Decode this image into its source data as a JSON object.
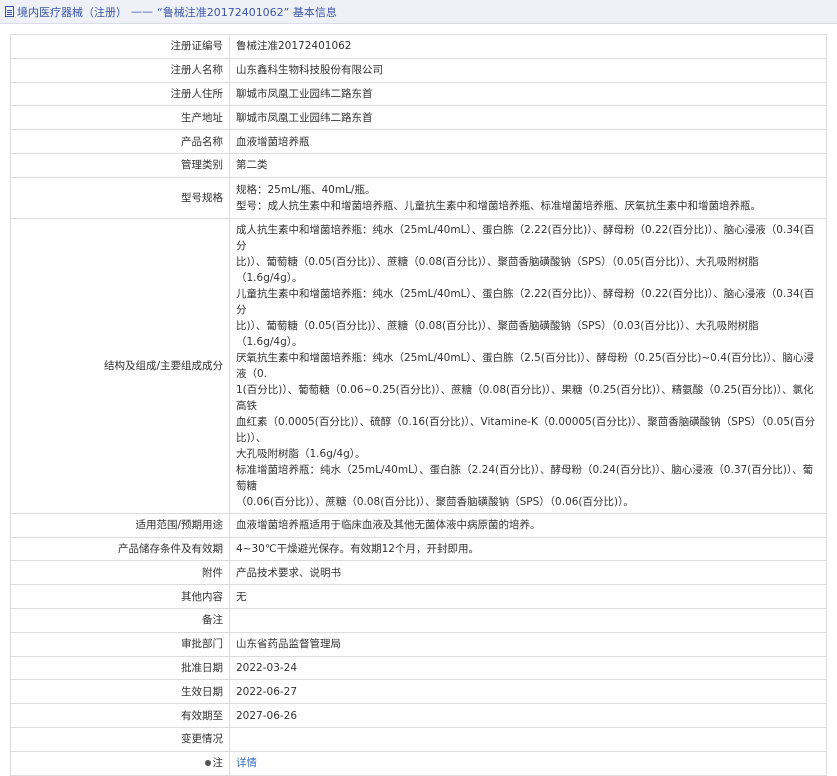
{
  "header": {
    "section": "境内医疗器械（注册）",
    "separator": "——",
    "title": "“鲁械注准20172401062” 基本信息"
  },
  "rows": [
    {
      "label": "注册证编号",
      "value": "鲁械注准20172401062"
    },
    {
      "label": "注册人名称",
      "value": "山东鑫科生物科技股份有限公司"
    },
    {
      "label": "注册人住所",
      "value": "聊城市凤凰工业园纬二路东首"
    },
    {
      "label": "生产地址",
      "value": "聊城市凤凰工业园纬二路东首"
    },
    {
      "label": "产品名称",
      "value": "血液增菌培养瓶"
    },
    {
      "label": "管理类别",
      "value": "第二类"
    },
    {
      "label": "型号规格",
      "lines": [
        "规格：25mL/瓶、40mL/瓶。",
        "型号：成人抗生素中和增菌培养瓶、儿童抗生素中和增菌培养瓶、标准增菌培养瓶、厌氧抗生素中和增菌培养瓶。"
      ]
    },
    {
      "label": "结构及组成/主要组成成分",
      "lines": [
        "成人抗生素中和增菌培养瓶：纯水（25mL/40mL）、蛋白胨（2.22(百分比)）、酵母粉（0.22(百分比)）、脑心浸液（0.34(百分",
        "比)）、葡萄糖（0.05(百分比)）、蔗糖（0.08(百分比)）、聚茴香脑磺酸钠（SPS）（0.05(百分比)）、大孔吸附树脂（1.6g/4g）。",
        "儿童抗生素中和增菌培养瓶：纯水（25mL/40mL）、蛋白胨（2.22(百分比)）、酵母粉（0.22(百分比)）、脑心浸液（0.34(百分",
        "比)）、葡萄糖（0.05(百分比)）、蔗糖（0.08(百分比)）、聚茴香脑磺酸钠（SPS）（0.03(百分比)）、大孔吸附树脂（1.6g/4g）。",
        "厌氧抗生素中和增菌培养瓶：纯水（25mL/40mL）、蛋白胨（2.5(百分比)）、酵母粉（0.25(百分比)~0.4(百分比)）、脑心浸液（0.",
        "1(百分比)）、葡萄糖（0.06~0.25(百分比)）、蔗糖（0.08(百分比)）、果糖（0.25(百分比)）、精氨酸（0.25(百分比)）、氯化高铁",
        "血红素（0.0005(百分比)）、硫醇（0.16(百分比)）、Vitamine-K（0.00005(百分比)）、聚茴香脑磺酸钠（SPS）（0.05(百分比)）、",
        "大孔吸附树脂（1.6g/4g）。",
        "标准增菌培养瓶：纯水（25mL/40mL）、蛋白胨（2.24(百分比)）、酵母粉（0.24(百分比)）、脑心浸液（0.37(百分比)）、葡萄糖",
        "（0.06(百分比)）、蔗糖（0.08(百分比)）、聚茴香脑磺酸钠（SPS）（0.06(百分比)）。"
      ]
    },
    {
      "label": "适用范围/预期用途",
      "value": "血液增菌培养瓶适用于临床血液及其他无菌体液中病原菌的培养。"
    },
    {
      "label": "产品储存条件及有效期",
      "value": "4~30℃干燥避光保存。有效期12个月，开封即用。"
    },
    {
      "label": "附件",
      "value": "产品技术要求、说明书"
    },
    {
      "label": "其他内容",
      "value": "无"
    },
    {
      "label": "备注",
      "value": ""
    },
    {
      "label": "审批部门",
      "value": "山东省药品监督管理局"
    },
    {
      "label": "批准日期",
      "value": "2022-03-24"
    },
    {
      "label": "生效日期",
      "value": "2022-06-27"
    },
    {
      "label": "有效期至",
      "value": "2027-06-26"
    },
    {
      "label": "变更情况",
      "value": ""
    },
    {
      "label": "注",
      "value": "详情"
    }
  ]
}
